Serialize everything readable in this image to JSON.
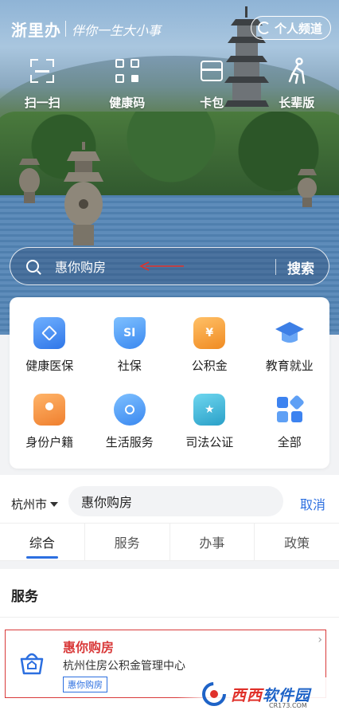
{
  "header": {
    "app_name": "浙里办",
    "slogan": "伴你一生大小事",
    "channel_button": "个人频道"
  },
  "quick_actions": [
    {
      "label": "扫一扫",
      "icon": "scan-icon"
    },
    {
      "label": "健康码",
      "icon": "qr-code-icon"
    },
    {
      "label": "卡包",
      "icon": "card-wallet-icon"
    },
    {
      "label": "长辈版",
      "icon": "elder-mode-icon"
    }
  ],
  "search": {
    "value": "惠你购房",
    "button": "搜索"
  },
  "services": [
    {
      "label": "健康医保",
      "icon": "medical-insurance-icon",
      "color": "#3a86f0"
    },
    {
      "label": "社保",
      "icon": "social-security-icon",
      "color": "#4a9bf3"
    },
    {
      "label": "公积金",
      "icon": "housing-fund-icon",
      "color": "#f3a13a"
    },
    {
      "label": "教育就业",
      "icon": "education-icon",
      "color": "#3d7fe6"
    },
    {
      "label": "身份户籍",
      "icon": "identity-icon",
      "color": "#f39a40"
    },
    {
      "label": "生活服务",
      "icon": "life-service-icon",
      "color": "#4a9bf3"
    },
    {
      "label": "司法公证",
      "icon": "justice-icon",
      "color": "#3fb7d6"
    },
    {
      "label": "全部",
      "icon": "all-apps-icon",
      "color": "#3d83f0"
    }
  ],
  "results_bar": {
    "city": "杭州市",
    "query": "惠你购房",
    "cancel": "取消"
  },
  "tabs": [
    {
      "label": "综合",
      "active": true
    },
    {
      "label": "服务",
      "active": false
    },
    {
      "label": "办事",
      "active": false
    },
    {
      "label": "政策",
      "active": false
    }
  ],
  "section": {
    "title": "服务"
  },
  "result": {
    "title": "惠你购房",
    "subtitle": "杭州住房公积金管理中心",
    "tag": "惠你购房"
  },
  "watermark": {
    "brand_a": "西西",
    "brand_b": "软件园",
    "url": "CR173.COM"
  },
  "colors": {
    "accent": "#2c6fe0",
    "highlight_red": "#d93a3a"
  }
}
